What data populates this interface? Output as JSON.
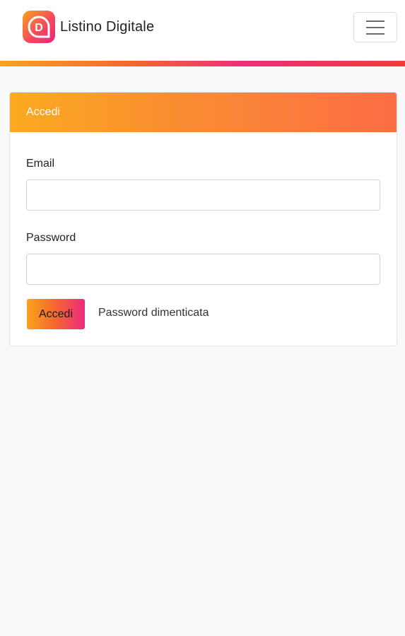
{
  "navbar": {
    "brand_name": "Listino Digitale",
    "logo_letter": "D",
    "menu_icon": "hamburger-menu-icon",
    "stripe_colors": [
      "#f9a21e",
      "#f76b2c",
      "#ef2d7a",
      "#f53a3a"
    ]
  },
  "login_card": {
    "header_title": "Accedi",
    "email_label": "Email",
    "email_value": "",
    "password_label": "Password",
    "password_value": "",
    "submit_label": "Accedi",
    "forgot_link": "Password dimenticata"
  },
  "colors": {
    "accent_orange": "#fbaa20",
    "accent_pink": "#ec2b7e",
    "background": "#f8f9fb"
  }
}
